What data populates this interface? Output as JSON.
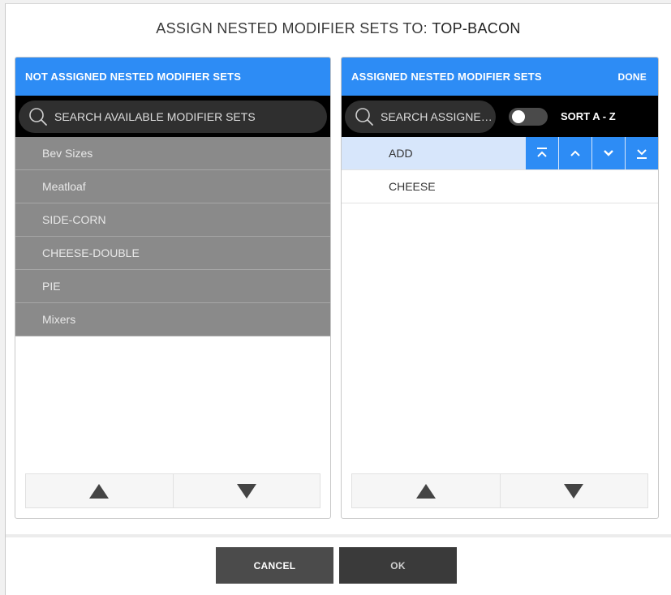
{
  "dialog": {
    "title_prefix": "ASSIGN NESTED MODIFIER SETS TO:",
    "title_target": "TOP-BACON"
  },
  "left_panel": {
    "header": "NOT ASSIGNED NESTED MODIFIER SETS",
    "search_placeholder": "SEARCH AVAILABLE MODIFIER SETS",
    "items": [
      "Bev Sizes",
      "Meatloaf",
      "SIDE-CORN",
      "CHEESE-DOUBLE",
      "PIE",
      "Mixers"
    ]
  },
  "right_panel": {
    "header": "ASSIGNED NESTED MODIFIER SETS",
    "done_label": "DONE",
    "search_placeholder": "SEARCH ASSIGNED...",
    "sort_label": "SORT A - Z",
    "items": [
      {
        "label": "ADD",
        "selected": true
      },
      {
        "label": "CHEESE",
        "selected": false
      }
    ]
  },
  "footer": {
    "cancel_label": "CANCEL",
    "ok_label": "OK"
  },
  "colors": {
    "accent": "#2d8cf5",
    "search_bar": "#000000",
    "unassigned_row": "#8a8a8a",
    "selected_row": "#d7e6fb",
    "footer_button": "#4b4b4b"
  }
}
